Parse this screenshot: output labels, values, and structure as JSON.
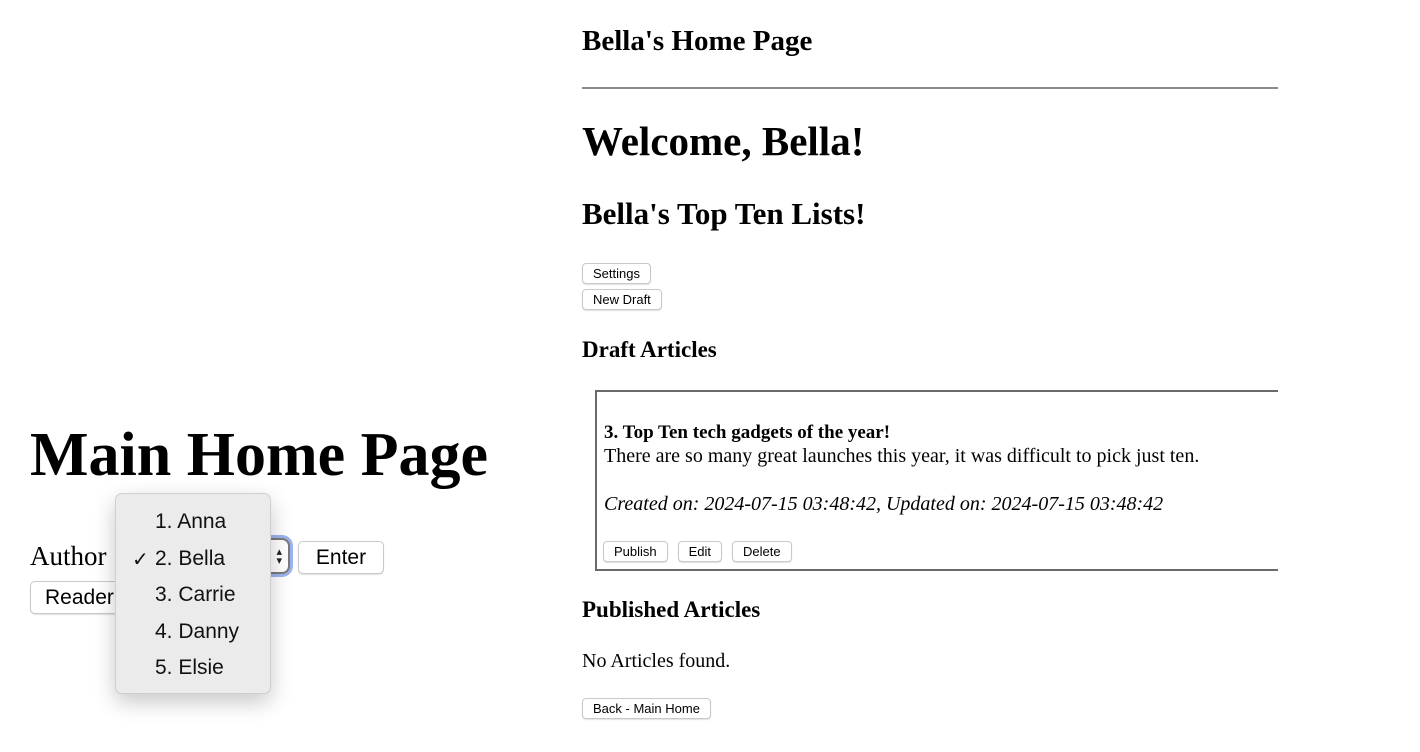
{
  "main": {
    "title": "Main Home Page",
    "author_label": "Author",
    "enter_label": "Enter",
    "reader_label": "Reader",
    "dropdown": {
      "selected_index": 1,
      "options": [
        "1. Anna",
        "2. Bella",
        "3. Carrie",
        "4. Danny",
        "5. Elsie"
      ],
      "check_glyph": "✓"
    }
  },
  "author_page": {
    "site_title": "Bella's Home Page",
    "welcome": "Welcome, Bella!",
    "lists_title": "Bella's Top Ten Lists!",
    "settings_label": "Settings",
    "new_draft_label": "New Draft",
    "draft_heading": "Draft Articles",
    "draft_articles": [
      {
        "title": "3. Top Ten tech gadgets of the year!",
        "body": "There are so many great launches this year, it was difficult to pick just ten.",
        "meta": "Created on: 2024-07-15 03:48:42, Updated on: 2024-07-15 03:48:42",
        "publish_label": "Publish",
        "edit_label": "Edit",
        "delete_label": "Delete"
      }
    ],
    "published_heading": "Published Articles",
    "no_articles": "No Articles found.",
    "back_label": "Back - Main Home"
  },
  "colors": {
    "focus_ring": "#9db3ee",
    "dropdown_bg": "#ebebeb"
  }
}
